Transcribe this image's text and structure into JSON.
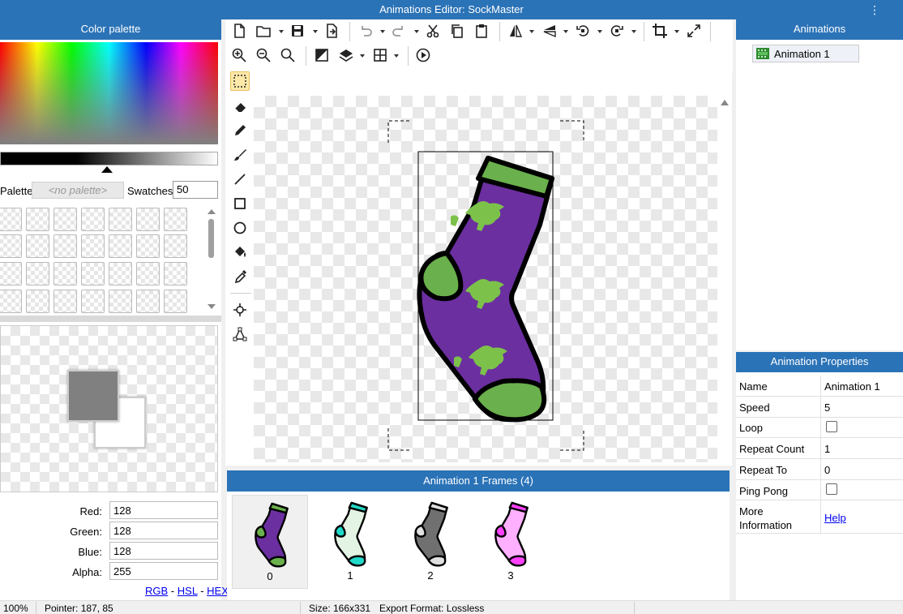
{
  "window": {
    "title": "Animations Editor: SockMaster"
  },
  "color_panel": {
    "title": "Color palette",
    "palette_label": "Palette",
    "palette_value": "<no palette>",
    "swatches_label": "Swatches",
    "swatches_value": "50",
    "foreground_color": "#808080",
    "background_color": "#ffffff",
    "red_label": "Red:",
    "red": "128",
    "green_label": "Green:",
    "green": "128",
    "blue_label": "Blue:",
    "blue": "128",
    "alpha_label": "Alpha:",
    "alpha": "255",
    "links": {
      "rgb": "RGB",
      "hsl": "HSL",
      "hex": "HEX",
      "sep": "-"
    }
  },
  "toolbar": {
    "row1": [
      "new-file-icon",
      "open-folder-icon",
      "save-icon",
      "export-icon",
      "undo-icon",
      "redo-icon",
      "cut-icon",
      "copy-icon",
      "paste-icon",
      "flip-horizontal-icon",
      "flip-vertical-icon",
      "rotate-left-icon",
      "rotate-right-icon",
      "crop-icon",
      "resize-icon"
    ],
    "row2": [
      "zoom-in-icon",
      "zoom-out-icon",
      "zoom-actual-icon",
      "invert-icon",
      "layers-icon",
      "grid-icon",
      "play-icon"
    ]
  },
  "tools": [
    "select-rect-icon",
    "eraser-icon",
    "pencil-icon",
    "brush-icon",
    "line-icon",
    "rectangle-icon",
    "ellipse-icon",
    "fill-bucket-icon",
    "eyedropper-icon",
    "pivot-icon",
    "shape-vertex-icon"
  ],
  "frames_panel": {
    "title": "Animation 1 Frames (4)",
    "frames": [
      {
        "label": "0",
        "body": "#6b2fa0",
        "trim": "#6ab04c",
        "selected": true
      },
      {
        "label": "1",
        "body": "#e4f4e4",
        "trim": "#20d8c8",
        "selected": false
      },
      {
        "label": "2",
        "body": "#707070",
        "trim": "#e0e0e0",
        "selected": false
      },
      {
        "label": "3",
        "body": "#ffb0ff",
        "trim": "#ff40ff",
        "selected": false
      }
    ]
  },
  "animations_panel": {
    "title": "Animations",
    "items": [
      "Animation 1"
    ]
  },
  "properties_panel": {
    "title": "Animation Properties",
    "name_label": "Name",
    "name_value": "Animation 1",
    "speed_label": "Speed",
    "speed_value": "5",
    "loop_label": "Loop",
    "repeat_count_label": "Repeat Count",
    "repeat_count_value": "1",
    "repeat_to_label": "Repeat To",
    "repeat_to_value": "0",
    "ping_pong_label": "Ping Pong",
    "more_info_label_1": "More",
    "more_info_label_2": "Information",
    "help_link": "Help"
  },
  "status": {
    "zoom": "100%",
    "pointer": "Pointer: 187, 85",
    "size": "Size: 166x331",
    "export_format": "Export Format: Lossless"
  }
}
